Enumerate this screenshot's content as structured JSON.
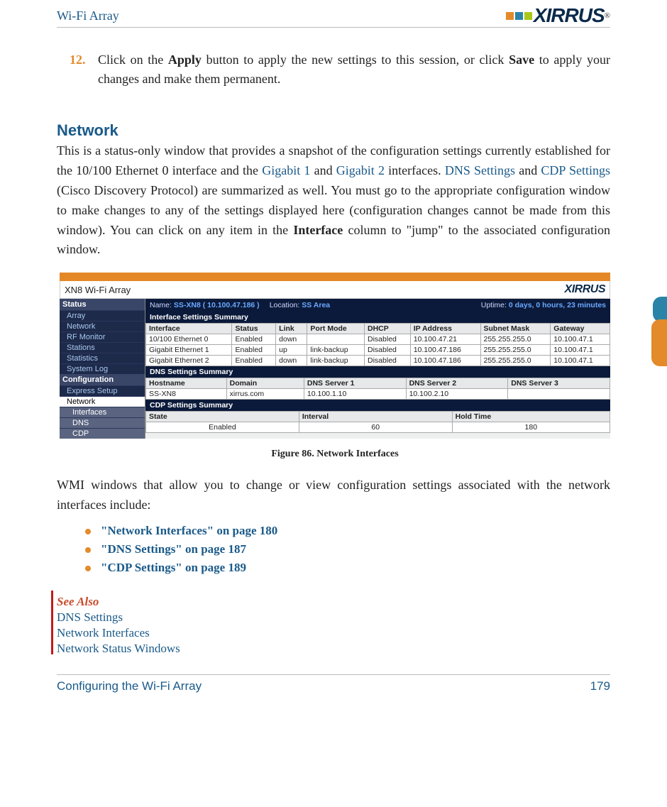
{
  "header": {
    "title": "Wi-Fi Array",
    "logo_text": "XIRRUS"
  },
  "step": {
    "num": "12.",
    "text_prefix": "Click on the ",
    "btn1": "Apply",
    "text_mid": " button to apply the new settings to this session, or click ",
    "btn2": "Save",
    "text_end": " to apply your changes and make them permanent."
  },
  "section": {
    "heading": "Network",
    "p1a": "This is a status-only window that provides a snapshot of the configuration settings currently established for the 10/100 Ethernet 0 interface and the ",
    "link_g1": "Gigabit 1",
    "p1b": " and ",
    "link_g2": "Gigabit 2",
    "p1c": " interfaces. ",
    "link_dns": "DNS Settings",
    "p1d": " and ",
    "link_cdp": "CDP Settings",
    "p1e": " (Cisco Discovery Protocol) are summarized as well. You must go to the appropriate configuration window to make changes to any of the settings displayed here (configuration changes cannot be made from this window). You can click on any item in the ",
    "bold_iface": "Interface",
    "p1f": " column to \"jump\" to the associated configuration window."
  },
  "figure": {
    "window_title": "XN8 Wi-Fi Array",
    "logo": "XIRRUS",
    "status": {
      "name_lbl": "Name:",
      "name_val": "SS-XN8 ( 10.100.47.186 )",
      "loc_lbl": "Location:",
      "loc_val": "SS Area",
      "up_lbl": "Uptime:",
      "up_val": "0 days, 0 hours, 23 minutes"
    },
    "sidebar": {
      "status_head": "Status",
      "items1": [
        "Array",
        "Network",
        "RF Monitor",
        "Stations",
        "Statistics",
        "System Log"
      ],
      "config_head": "Configuration",
      "express": "Express Setup",
      "network": "Network",
      "subs": [
        "Interfaces",
        "DNS",
        "CDP"
      ]
    },
    "sec1": "Interface Settings Summary",
    "tbl1_head": [
      "Interface",
      "Status",
      "Link",
      "Port Mode",
      "DHCP",
      "IP Address",
      "Subnet Mask",
      "Gateway"
    ],
    "tbl1_rows": [
      [
        "10/100 Ethernet 0",
        "Enabled",
        "down",
        "",
        "Disabled",
        "10.100.47.21",
        "255.255.255.0",
        "10.100.47.1"
      ],
      [
        "Gigabit Ethernet 1",
        "Enabled",
        "up",
        "link-backup",
        "Disabled",
        "10.100.47.186",
        "255.255.255.0",
        "10.100.47.1"
      ],
      [
        "Gigabit Ethernet 2",
        "Enabled",
        "down",
        "link-backup",
        "Disabled",
        "10.100.47.186",
        "255.255.255.0",
        "10.100.47.1"
      ]
    ],
    "sec2": "DNS Settings Summary",
    "tbl2_head": [
      "Hostname",
      "Domain",
      "DNS Server 1",
      "DNS Server 2",
      "DNS Server 3"
    ],
    "tbl2_rows": [
      [
        "SS-XN8",
        "xirrus.com",
        "10.100.1.10",
        "10.100.2.10",
        ""
      ]
    ],
    "sec3": "CDP Settings Summary",
    "tbl3_head": [
      "State",
      "Interval",
      "Hold Time"
    ],
    "tbl3_rows": [
      [
        "Enabled",
        "60",
        "180"
      ]
    ],
    "caption": "Figure 86. Network Interfaces"
  },
  "after_fig": "WMI windows that allow you to change or view configuration settings associated with the network interfaces include:",
  "bullets": [
    "\"Network Interfaces\" on page 180",
    "\"DNS Settings\" on page 187",
    "\"CDP Settings\" on page 189"
  ],
  "seealso": {
    "title": "See Also",
    "links": [
      "DNS Settings",
      "Network Interfaces",
      "Network Status Windows"
    ]
  },
  "footer": {
    "left": "Configuring the Wi-Fi Array",
    "right": "179"
  }
}
